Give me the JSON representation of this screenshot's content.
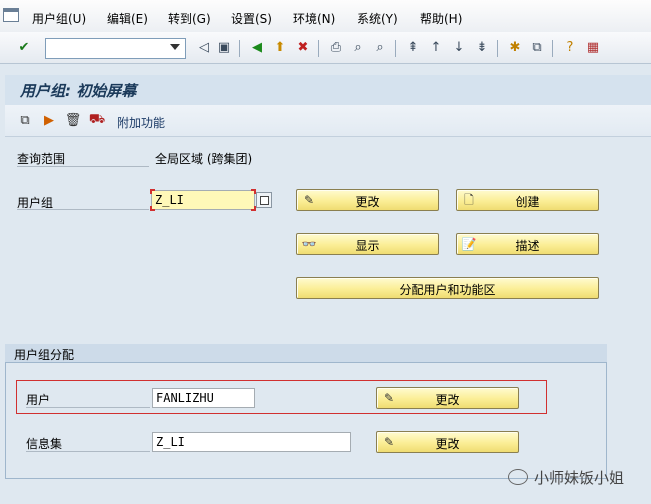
{
  "menu": {
    "items": [
      "用户组(U)",
      "编辑(E)",
      "转到(G)",
      "设置(S)",
      "环境(N)",
      "系统(Y)",
      "帮助(H)"
    ]
  },
  "toolbar": {
    "command_field_value": "",
    "icons": [
      "enter-icon",
      "save-icon",
      "back-icon",
      "exit-icon",
      "cancel-icon",
      "print-icon",
      "find-icon",
      "find-next-icon",
      "first-page-icon",
      "previous-page-icon",
      "next-page-icon",
      "last-page-icon",
      "create-session-icon",
      "shortcut-icon",
      "help-icon",
      "layout-icon"
    ]
  },
  "title": "用户组: 初始屏幕",
  "app_toolbar": {
    "extras_label": "附加功能"
  },
  "form": {
    "query_scope_label": "查询范围",
    "query_scope_value": "全局区域 (跨集团)",
    "user_group_label": "用户组",
    "user_group_value": "Z_LI"
  },
  "buttons": {
    "change": "更改",
    "create": "创建",
    "display": "显示",
    "describe": "描述",
    "assign_users": "分配用户和功能区"
  },
  "assignment": {
    "section_title": "用户组分配",
    "user_label": "用户",
    "user_value": "FANLIZHU",
    "user_change": "更改",
    "infoset_label": "信息集",
    "infoset_value": "Z_LI",
    "infoset_change": "更改"
  },
  "watermark": {
    "text": "小师妹饭小姐"
  },
  "colors": {
    "background": "#dfe8f0",
    "button_yellow": "#fbee96",
    "focus_field": "#fff8b8",
    "highlight_red": "#d13030"
  }
}
